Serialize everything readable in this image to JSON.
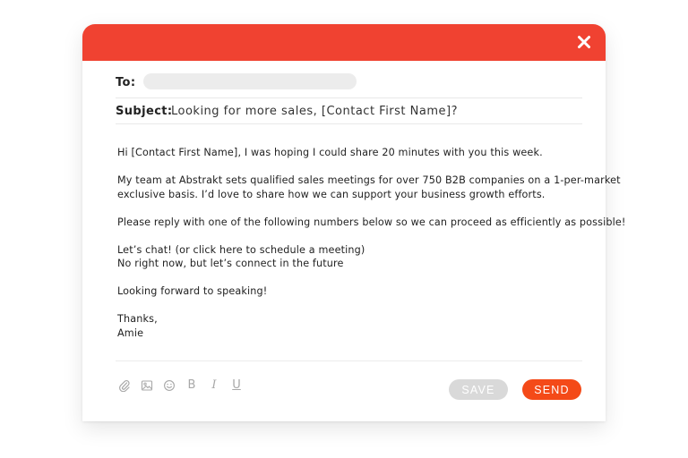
{
  "colors": {
    "titlebar": "#f04231",
    "send_button": "#f44a18",
    "save_button": "#d9d9d9",
    "close_icon": "#ffffff"
  },
  "titlebar": {
    "close_icon": "close-icon"
  },
  "header": {
    "to_label": "To:",
    "to_value": "",
    "subject_label": "Subject:",
    "subject_value": "Looking for more sales, [Contact First Name]?"
  },
  "body": {
    "greeting": "Hi [Contact First Name], I was hoping I could share 20 minutes with you this week.",
    "paragraph_1_line_1": "My team at Abstrakt sets qualified sales meetings for over 750 B2B companies on a 1-per-market",
    "paragraph_1_line_2": "exclusive basis. I’d love to share how we can support your business growth efforts.",
    "paragraph_2": "Please reply with one of the following numbers below so we can proceed as efficiently as possible!",
    "option_1": "Let’s chat! (or click here to schedule a meeting)",
    "option_2": "No right now, but let’s connect in the future",
    "closing": "Looking forward to speaking!",
    "signoff": "Thanks,",
    "signature": "Amie"
  },
  "toolbar": {
    "icons": [
      "paperclip-icon",
      "image-icon",
      "smiley-icon",
      "bold-icon",
      "italic-icon",
      "underline-icon"
    ],
    "bold_label": "B",
    "italic_label": "I",
    "underline_label": "U",
    "save_label": "SAVE",
    "send_label": "SEND"
  }
}
